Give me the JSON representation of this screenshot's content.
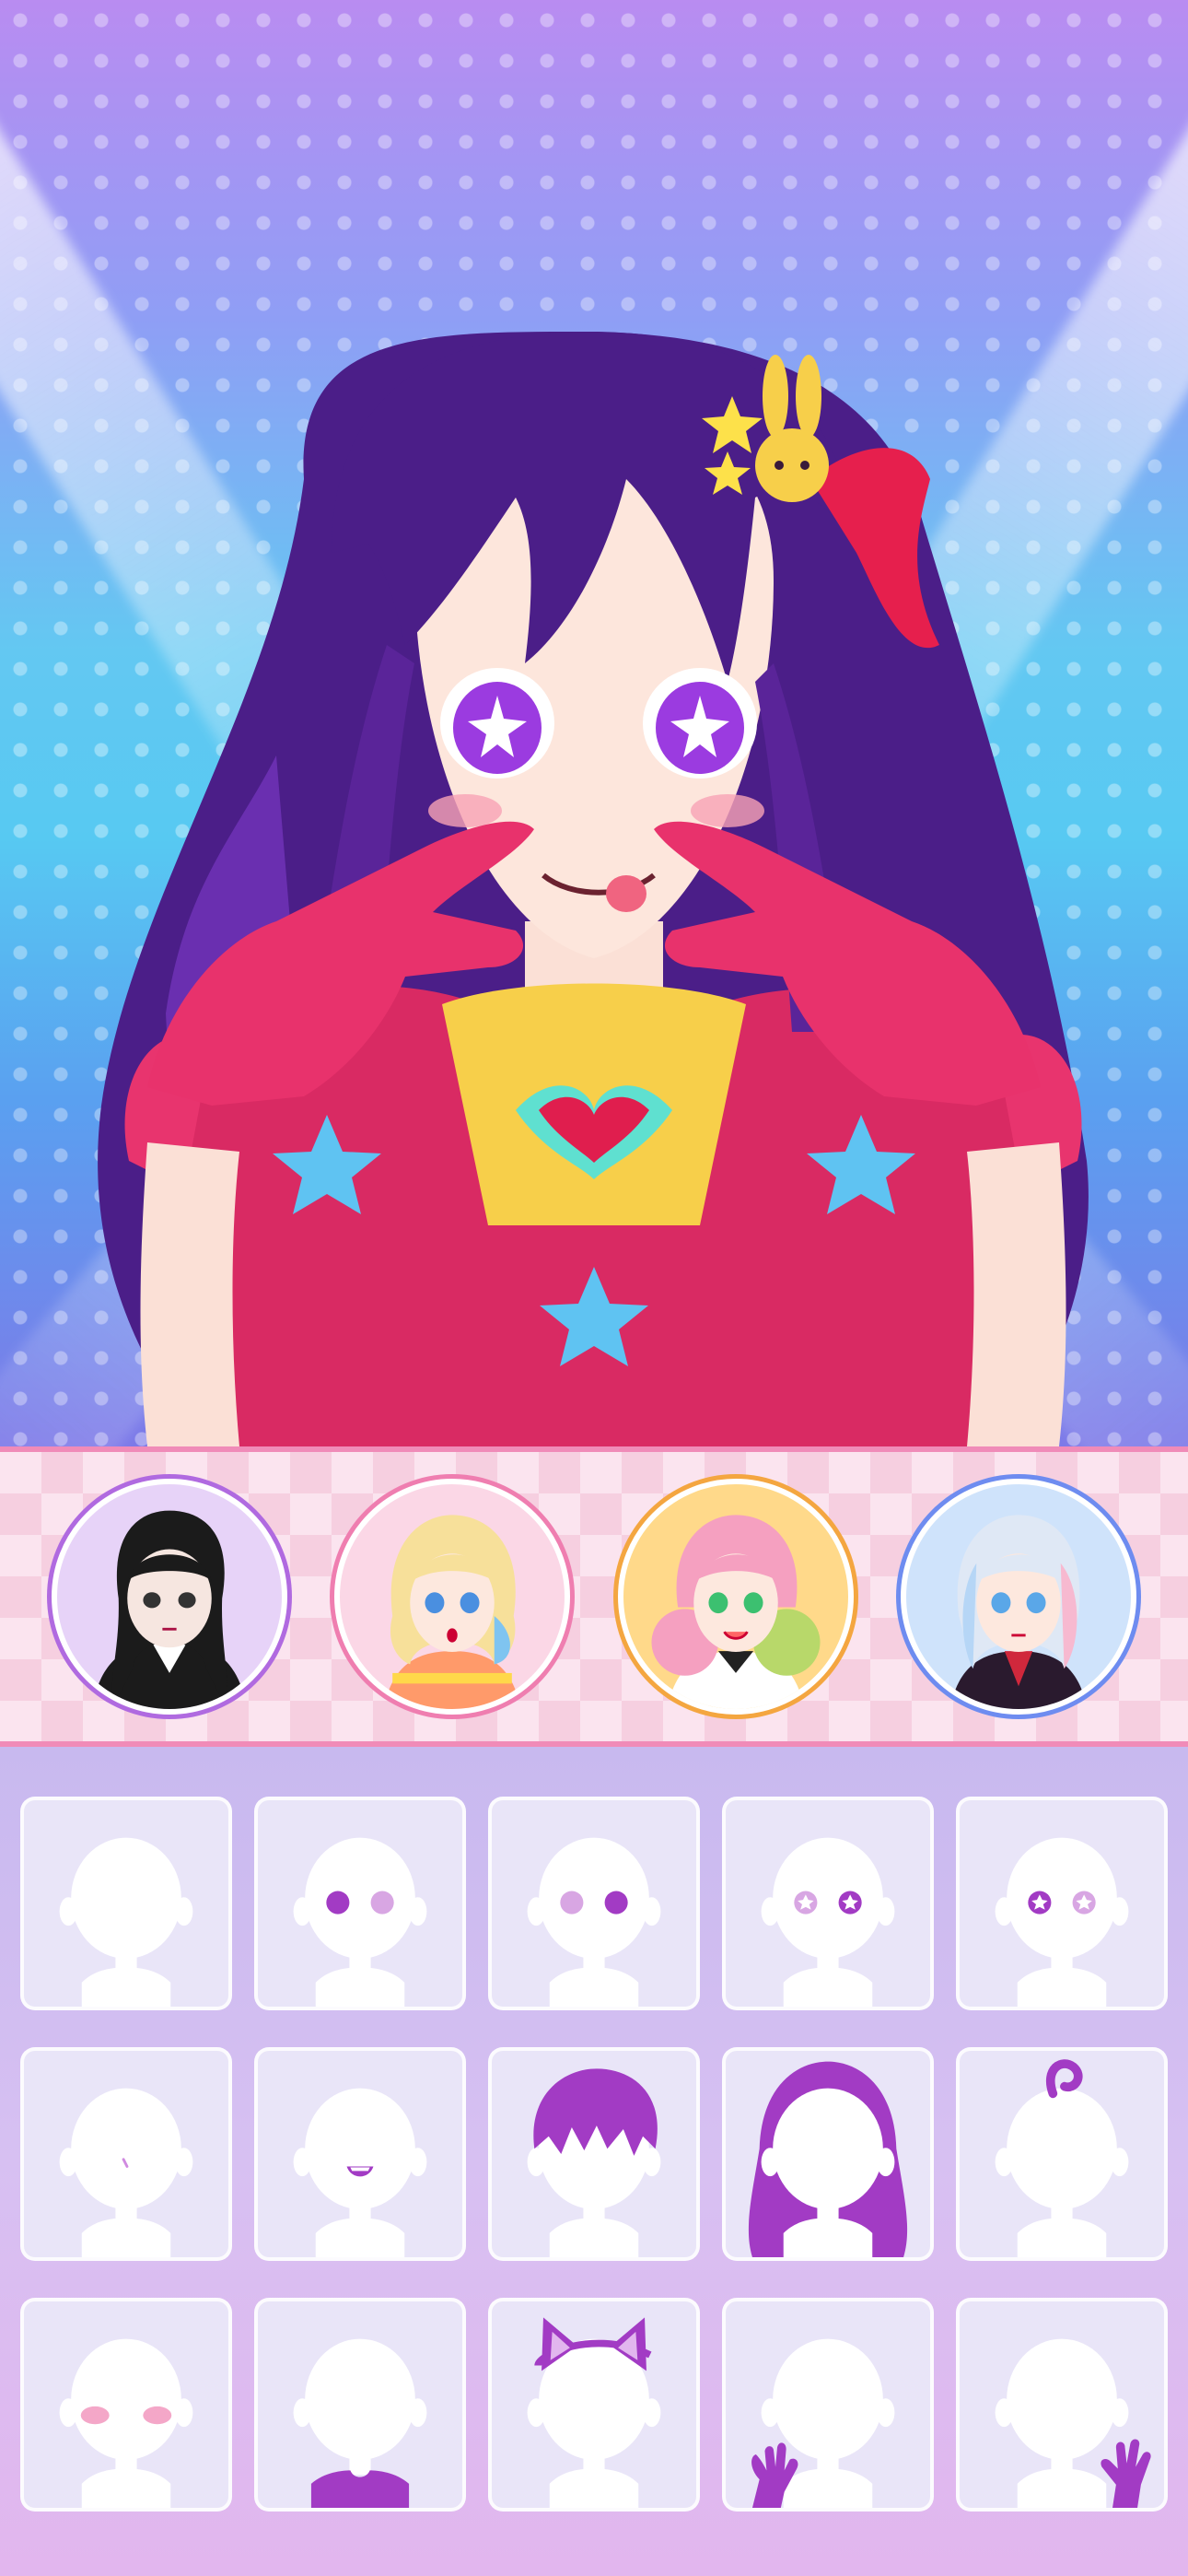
{
  "app": {
    "screen": "character-creator"
  },
  "colors": {
    "accent_purple": "#a23bc4",
    "accent_pink": "#f08bb8",
    "tile_bg": "#e9e5f8",
    "tile_silhouette": "#ffffff"
  },
  "presets": [
    {
      "icon": "preset-gothic-girl-icon",
      "ring": "#b06ae0",
      "bg": "#e7d3f8"
    },
    {
      "icon": "preset-blonde-girl-icon",
      "ring": "#ef7eb0",
      "bg": "#fbd7e6"
    },
    {
      "icon": "preset-pink-hair-girl-icon",
      "ring": "#f4a640",
      "bg": "#ffd98a"
    },
    {
      "icon": "preset-silver-hair-girl-icon",
      "ring": "#6e8cf0",
      "bg": "#cfe3fb"
    }
  ],
  "parts": [
    {
      "icon": "skin-body-icon"
    },
    {
      "icon": "eyes-style-1-icon"
    },
    {
      "icon": "eyes-style-2-icon"
    },
    {
      "icon": "eyes-style-3-icon"
    },
    {
      "icon": "eyes-style-4-icon"
    },
    {
      "icon": "nose-icon"
    },
    {
      "icon": "mouth-icon"
    },
    {
      "icon": "front-hair-icon"
    },
    {
      "icon": "back-hair-icon"
    },
    {
      "icon": "hair-accessory-icon"
    },
    {
      "icon": "blush-icon"
    },
    {
      "icon": "top-clothing-icon"
    },
    {
      "icon": "cat-ears-icon"
    },
    {
      "icon": "gloves-icon"
    },
    {
      "icon": "hand-pose-icon"
    }
  ]
}
